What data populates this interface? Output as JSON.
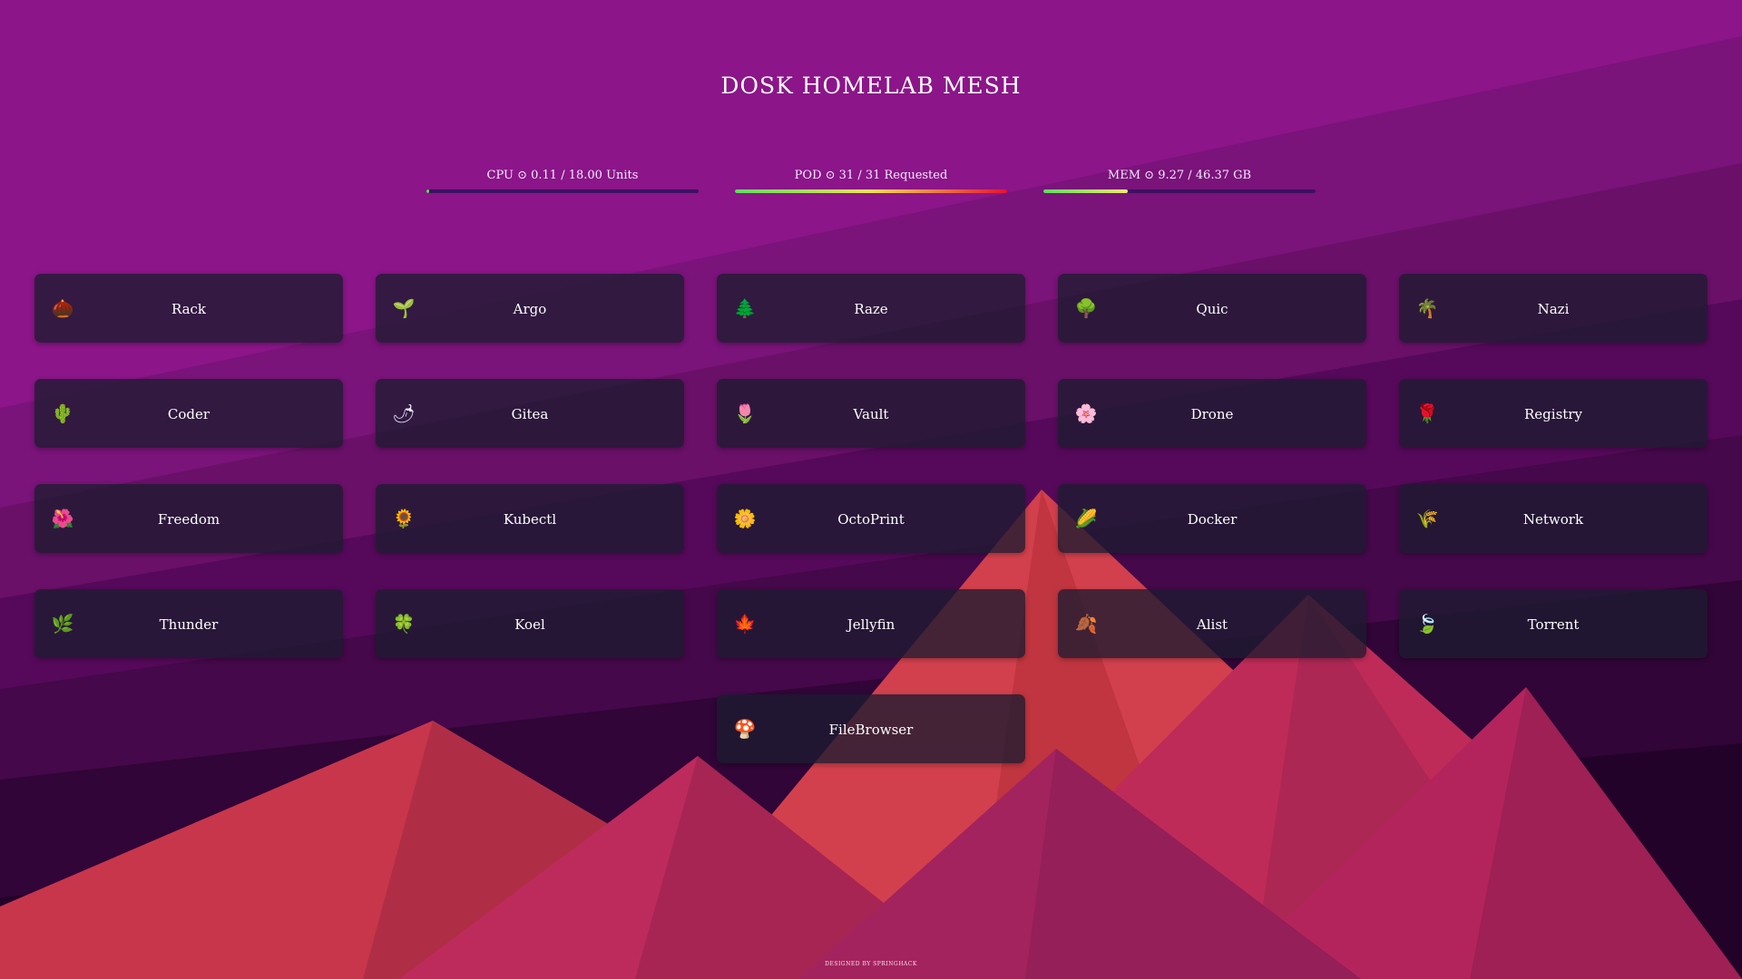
{
  "title": "DOSK HOMELAB MESH",
  "stats": [
    {
      "label": "CPU ⊙ 0.11 / 18.00 Units",
      "fill_fraction": 0.01,
      "gradient": [
        "#5de05d",
        "#5de05d"
      ]
    },
    {
      "label": "POD ⊙ 31 / 31 Requested",
      "fill_fraction": 1.0,
      "gradient": [
        "#5de05d",
        "#f0e05a",
        "#e8122e"
      ]
    },
    {
      "label": "MEM ⊙ 9.27 / 46.37 GB",
      "fill_fraction": 0.31,
      "gradient": [
        "#5de05d",
        "#f0e870"
      ]
    }
  ],
  "services": [
    {
      "name": "Rack",
      "icon": "🌰",
      "icon_name": "chestnut-icon"
    },
    {
      "name": "Argo",
      "icon": "🌱",
      "icon_name": "seedling-icon"
    },
    {
      "name": "Raze",
      "icon": "🌲",
      "icon_name": "evergreen-tree-icon"
    },
    {
      "name": "Quic",
      "icon": "🌳",
      "icon_name": "deciduous-tree-icon"
    },
    {
      "name": "Nazi",
      "icon": "🌴",
      "icon_name": "palm-tree-icon"
    },
    {
      "name": "Coder",
      "icon": "🌵",
      "icon_name": "cactus-icon"
    },
    {
      "name": "Gitea",
      "icon": "🌶",
      "icon_name": "hot-pepper-icon"
    },
    {
      "name": "Vault",
      "icon": "🌷",
      "icon_name": "tulip-icon"
    },
    {
      "name": "Drone",
      "icon": "🌸",
      "icon_name": "cherry-blossom-icon"
    },
    {
      "name": "Registry",
      "icon": "🌹",
      "icon_name": "rose-icon"
    },
    {
      "name": "Freedom",
      "icon": "🌺",
      "icon_name": "hibiscus-icon"
    },
    {
      "name": "Kubectl",
      "icon": "🌻",
      "icon_name": "sunflower-icon"
    },
    {
      "name": "OctoPrint",
      "icon": "🌼",
      "icon_name": "blossom-icon"
    },
    {
      "name": "Docker",
      "icon": "🌽",
      "icon_name": "corn-icon"
    },
    {
      "name": "Network",
      "icon": "🌾",
      "icon_name": "rice-sheaf-icon"
    },
    {
      "name": "Thunder",
      "icon": "🌿",
      "icon_name": "herb-icon"
    },
    {
      "name": "Koel",
      "icon": "🍀",
      "icon_name": "four-leaf-clover-icon"
    },
    {
      "name": "Jellyfin",
      "icon": "🍁",
      "icon_name": "maple-leaf-icon"
    },
    {
      "name": "Alist",
      "icon": "🍂",
      "icon_name": "fallen-leaf-icon"
    },
    {
      "name": "Torrent",
      "icon": "🍃",
      "icon_name": "leaf-fluttering-icon"
    },
    {
      "name": "FileBrowser",
      "icon": "🍄",
      "icon_name": "mushroom-icon"
    }
  ],
  "footer": "DESIGNED BY SPRINGHACK"
}
